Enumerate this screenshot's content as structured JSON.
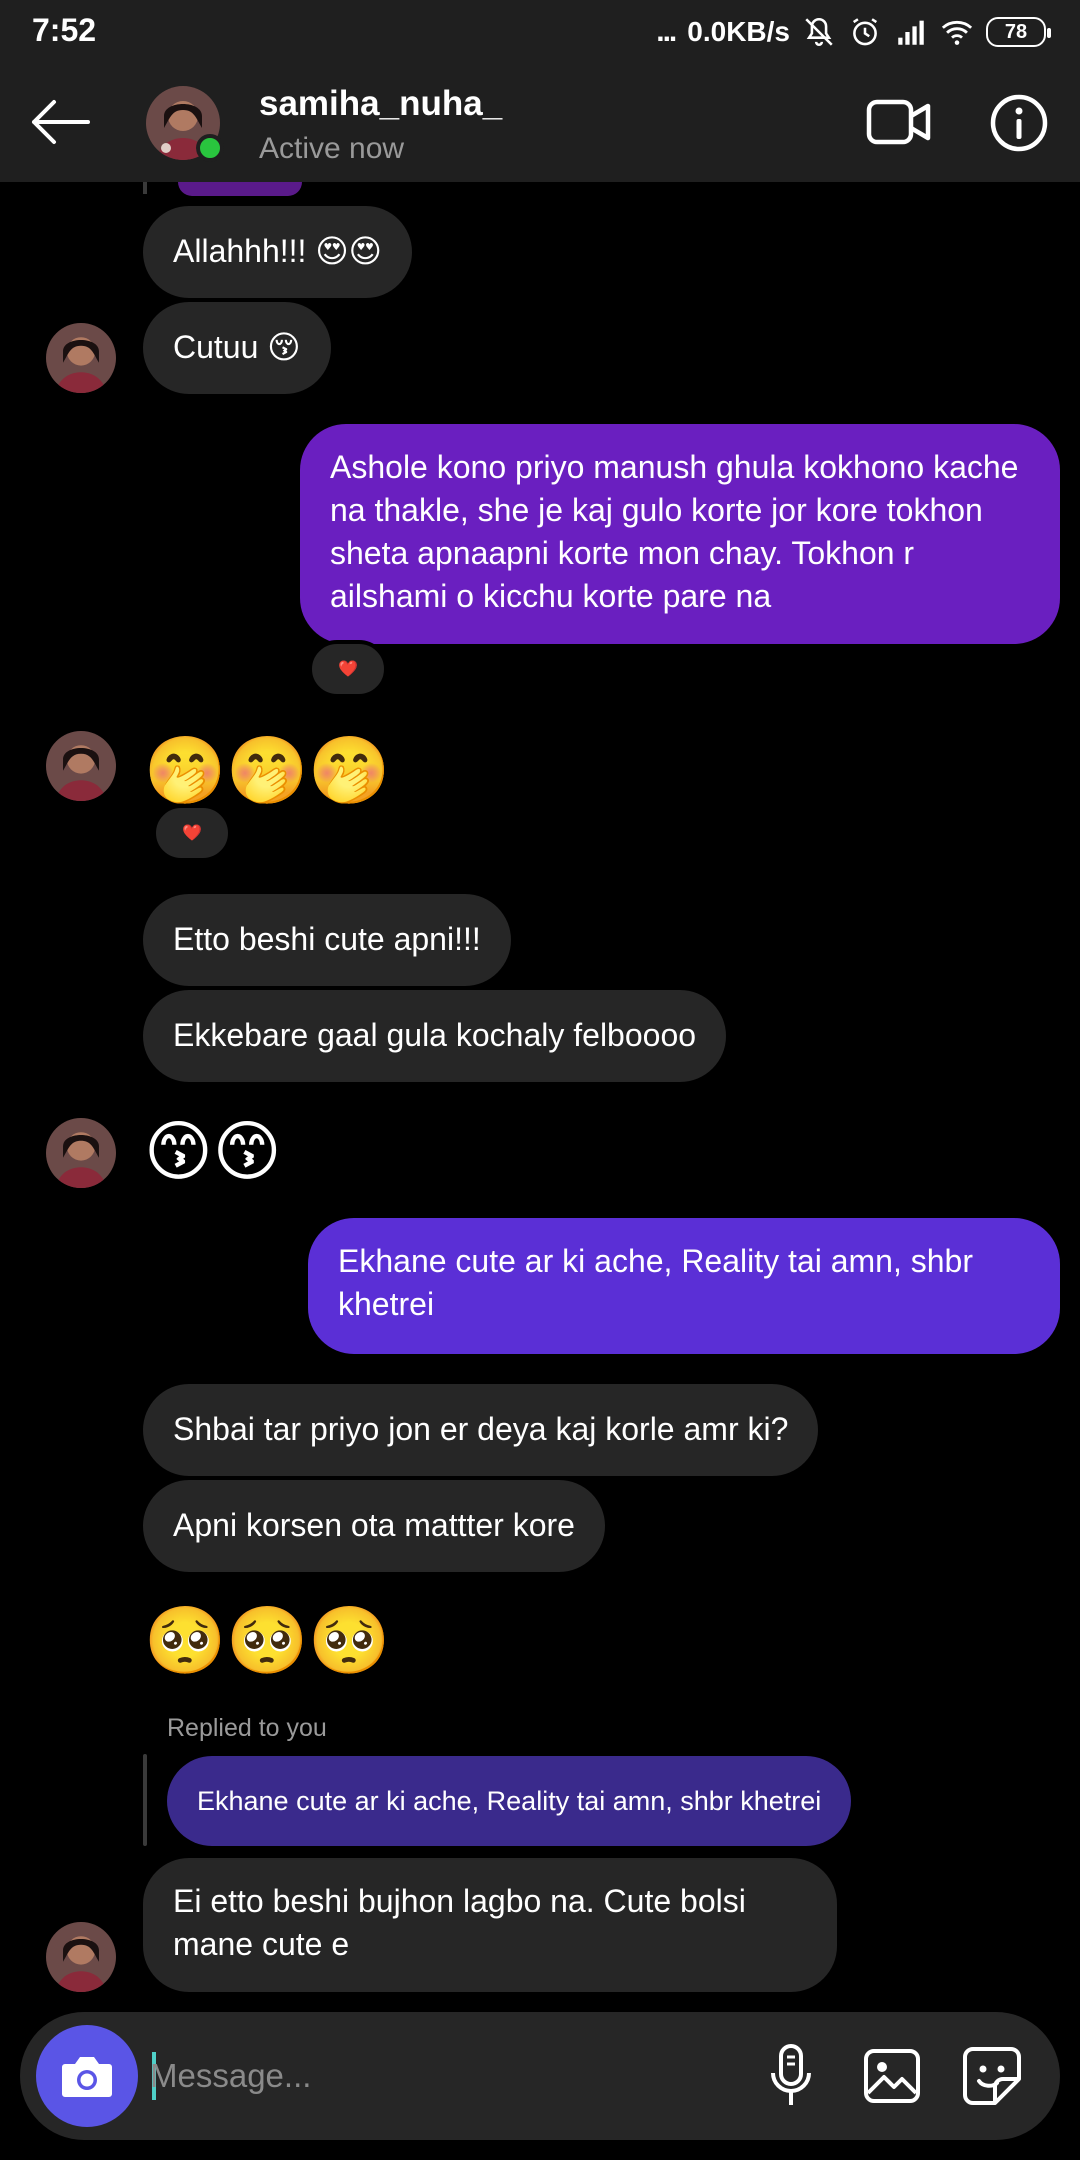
{
  "status_bar": {
    "time": "7:52",
    "dots": "...",
    "network_speed": "0.0KB/s",
    "battery": "78"
  },
  "header": {
    "contact_name": "samiha_nuha_",
    "status": "Active now",
    "icons": [
      "back-arrow-icon",
      "video-call-icon",
      "info-icon"
    ]
  },
  "messages": [
    {
      "side": "in",
      "text": "Allahhh!!! 😍😍"
    },
    {
      "side": "in",
      "text": "Cutuu 😚"
    },
    {
      "side": "out",
      "text": "Ashole kono priyo manush ghula kokhono kache na thakle, she je kaj gulo korte jor kore tokhon sheta apnaapni korte mon chay. Tokhon r ailshami o kicchu korte pare na",
      "reaction": "❤️"
    },
    {
      "side": "in",
      "emoji": "🤭🤭🤭",
      "reaction": "❤️"
    },
    {
      "side": "in",
      "text": "Etto beshi cute apni!!!"
    },
    {
      "side": "in",
      "text": "Ekkebare gaal gula kochaly felboooo"
    },
    {
      "side": "in",
      "emoji": "😙😙"
    },
    {
      "side": "out",
      "text": "Ekhane cute ar ki ache, Reality tai amn, shbr khetrei"
    },
    {
      "side": "in",
      "text": "Shbai tar priyo jon er deya kaj korle amr ki?"
    },
    {
      "side": "in",
      "text": "Apni korsen ota mattter kore"
    },
    {
      "side": "in",
      "emoji": "🥺🥺🥺"
    },
    {
      "side": "in",
      "reply_label": "Replied to you",
      "replied_text": "Ekhane cute ar ki ache, Reality tai amn, shbr khetrei",
      "text": "Ei etto beshi bujhon lagbo na. Cute bolsi mane cute e"
    }
  ],
  "composer": {
    "placeholder": "Message...",
    "icons": [
      "camera-icon",
      "microphone-icon",
      "gallery-icon",
      "sticker-icon"
    ]
  },
  "colors": {
    "background": "#000000",
    "bar": "#1f1f1f",
    "incoming_bubble": "#262626",
    "outgoing_bubble_1": "#6a1fc0",
    "outgoing_bubble_2": "#5b2fd6",
    "reply_bubble": "#3a2a8c",
    "online": "#29c53e",
    "camera_button": "#5a55e6"
  }
}
